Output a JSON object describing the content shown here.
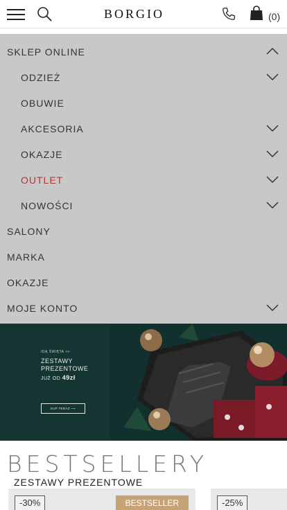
{
  "header": {
    "logo": "BORGIO",
    "cart_count": "(0)",
    "icons": [
      "hamburger-menu-icon",
      "search-icon",
      "phone-icon",
      "shopping-bag-icon"
    ]
  },
  "menu": {
    "items": [
      {
        "label": "SKLEP ONLINE",
        "chevron": "up"
      },
      {
        "label": "ODZIEŻ",
        "chevron": "down"
      },
      {
        "label": "OBUWIE",
        "chevron": "none"
      },
      {
        "label": "AKCESORIA",
        "chevron": "down"
      },
      {
        "label": "OKAZJE",
        "chevron": "down"
      },
      {
        "label": "OUTLET",
        "chevron": "down",
        "color": "#b1343b"
      },
      {
        "label": "NOWOŚCI",
        "chevron": "down"
      },
      {
        "label": "SALONY",
        "chevron": "none"
      },
      {
        "label": "MARKA",
        "chevron": "none"
      },
      {
        "label": "OKAZJE",
        "chevron": "none"
      },
      {
        "label": "MOJE KONTO",
        "chevron": "down"
      }
    ]
  },
  "banner": {
    "small": "IDĄ ŚWIĘTA >>",
    "title_line1": "ZESTAWY",
    "title_line2": "PREZENTOWE",
    "price_prefix": "JUŻ OD",
    "price": "49zł",
    "button": "KUP TERAZ ⟶"
  },
  "bestsellers": {
    "title": "BESTSELLERY",
    "subtitle": "ZESTAWY PREZENTOWE",
    "products": [
      {
        "discount": "-30%",
        "badge": "BESTSELLER"
      },
      {
        "discount": "-25%"
      }
    ]
  },
  "colors": {
    "menu_bg": "#c8c8c8",
    "accent_red": "#b1343b",
    "badge_gold": "#c6a277",
    "banner_green": "#153532"
  }
}
